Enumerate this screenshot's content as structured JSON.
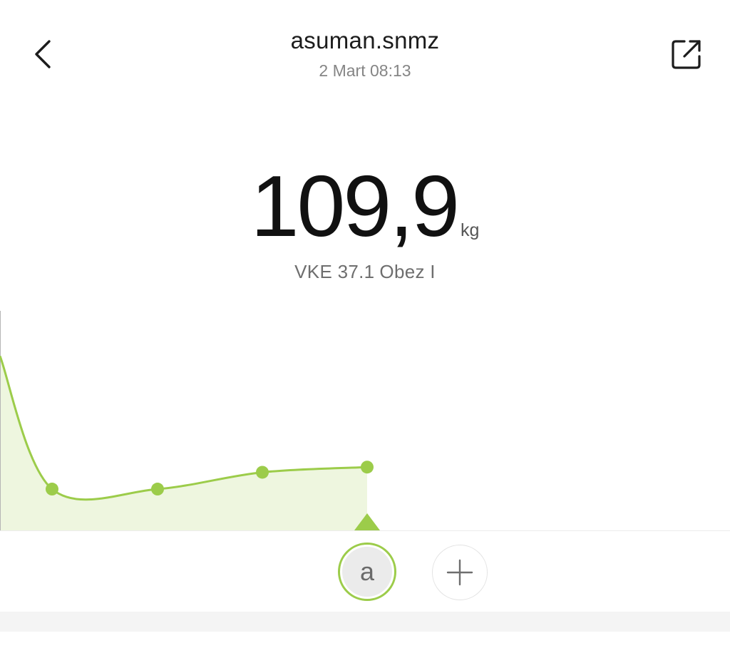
{
  "header": {
    "title": "asuman.snmz",
    "subtitle": "2 Mart 08:13",
    "back_icon": "chevron-left-icon",
    "share_icon": "share-external-icon"
  },
  "measurement": {
    "weight": "109,9",
    "unit": "kg",
    "bmi_label": "VKE 37.1",
    "bmi_category": "Obez I"
  },
  "chart_data": {
    "type": "area",
    "series": [
      {
        "values": [
          118.5,
          108.2,
          108.2,
          109.5,
          109.9
        ]
      }
    ],
    "selected_index": 4,
    "ylim": [
      105,
      122
    ],
    "grid": false
  },
  "users": {
    "current_user_initial": "a",
    "add_icon": "plus-icon"
  },
  "colors": {
    "accent": "#9ccc4a",
    "area_fill": "#eef6df",
    "text_primary": "#111111",
    "text_secondary": "#858585"
  }
}
